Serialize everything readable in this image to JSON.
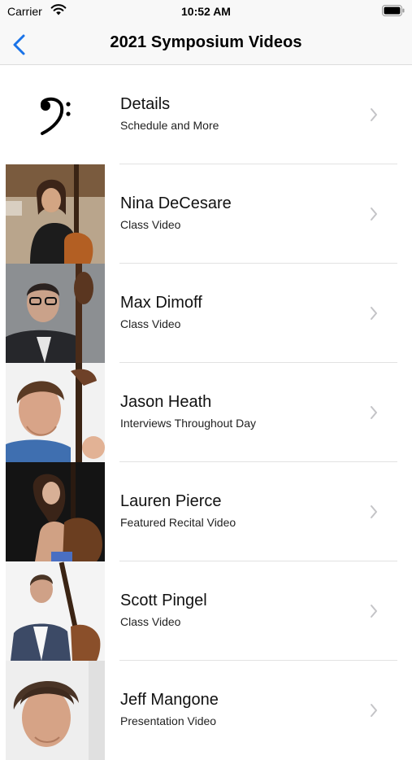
{
  "status_bar": {
    "carrier": "Carrier",
    "time": "10:52 AM"
  },
  "nav": {
    "title": "2021 Symposium Videos"
  },
  "rows": [
    {
      "title": "Details",
      "subtitle": "Schedule and More",
      "icon": "bass-clef-icon"
    },
    {
      "title": "Nina DeCesare",
      "subtitle": "Class Video",
      "photo": "nina-decesare-photo"
    },
    {
      "title": "Max Dimoff",
      "subtitle": "Class Video",
      "photo": "max-dimoff-photo"
    },
    {
      "title": "Jason Heath",
      "subtitle": "Interviews Throughout Day",
      "photo": "jason-heath-photo"
    },
    {
      "title": "Lauren Pierce",
      "subtitle": "Featured Recital Video",
      "photo": "lauren-pierce-photo"
    },
    {
      "title": "Scott Pingel",
      "subtitle": "Class Video",
      "photo": "scott-pingel-photo"
    },
    {
      "title": "Jeff Mangone",
      "subtitle": "Presentation Video",
      "photo": "jeff-mangone-photo"
    }
  ],
  "colors": {
    "accent": "#1a73e8",
    "chevron": "#c4c4c7",
    "separator": "#e2e2e2",
    "bar": "#f8f8f8"
  }
}
